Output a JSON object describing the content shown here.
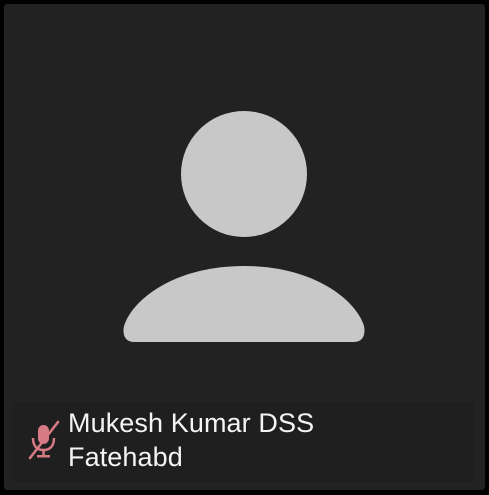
{
  "participant": {
    "name_line_1": "Mukesh Kumar DSS",
    "name_line_2": "Fatehabd",
    "mic_state": "muted",
    "avatar_icon": "person-silhouette-icon",
    "mic_icon": "mic-muted-icon"
  },
  "colors": {
    "background": "#000000",
    "tile_bg": "#222222",
    "avatar_fill": "#c8c8c8",
    "name_bar_bg": "#1f1f1f",
    "name_text": "#f4f4f4",
    "mic_muted": "#d67a83"
  }
}
